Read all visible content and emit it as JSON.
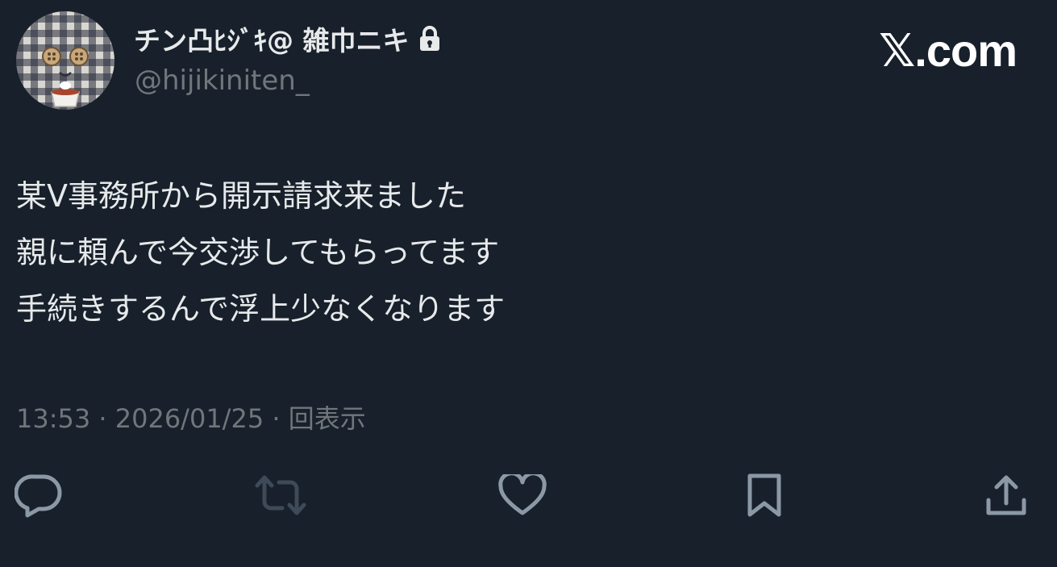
{
  "author": {
    "display_name": "チン凸ﾋｼﾞｷ@ 雑巾ニキ",
    "handle": "@hijikiniten_",
    "protected_icon": "lock-icon",
    "avatar_icon": "avatar"
  },
  "brand": {
    "logo": "𝕏.com"
  },
  "tweet": {
    "lines": [
      "某V事務所から開示請求来ました",
      "親に頼んで今交渉してもらってます",
      "手続きするんで浮上少なくなります"
    ],
    "meta": "13:53 · 2026/01/25 · 回表示"
  },
  "actions": {
    "icons": [
      "reply-icon",
      "retweet-icon",
      "like-icon",
      "bookmark-icon",
      "share-icon"
    ]
  },
  "colors": {
    "background": "#17202b",
    "text": "#e7e9ea",
    "secondary": "#71767b",
    "retweet_disabled": "#3e4a57"
  }
}
